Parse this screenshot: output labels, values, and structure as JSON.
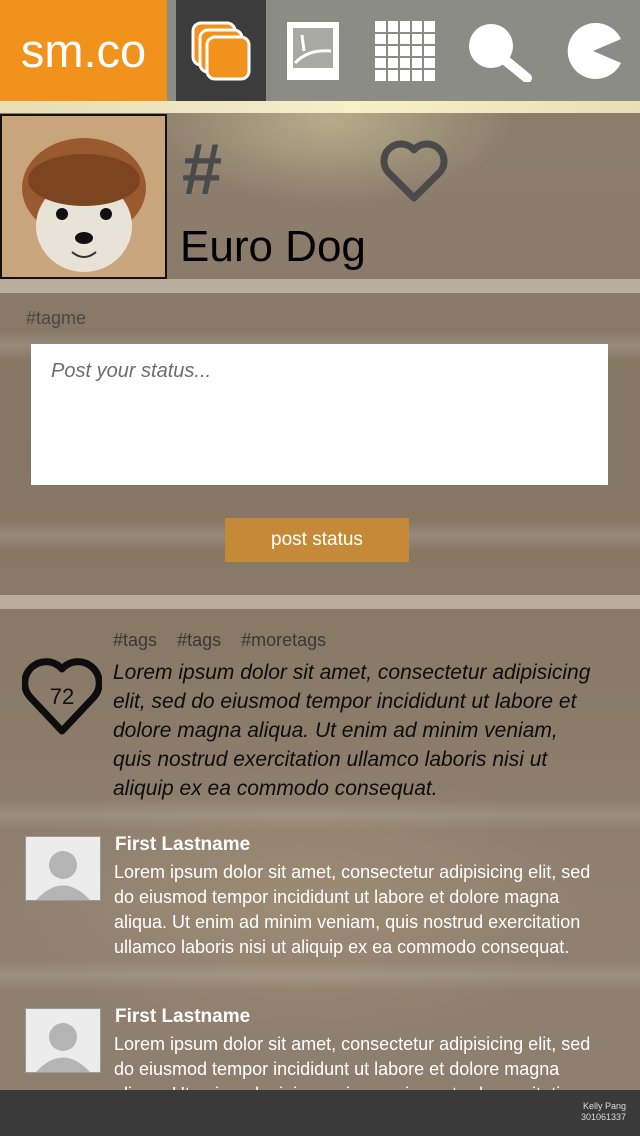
{
  "app": {
    "logo": "sm.co"
  },
  "nav": {
    "items": [
      {
        "name": "stack",
        "icon": "stack-icon",
        "active": true
      },
      {
        "name": "photos",
        "icon": "image-icon",
        "active": false
      },
      {
        "name": "calendar",
        "icon": "calendar-icon",
        "active": false
      },
      {
        "name": "search",
        "icon": "search-icon",
        "active": false
      },
      {
        "name": "chat",
        "icon": "pacman-icon",
        "active": false
      }
    ]
  },
  "profile": {
    "hash_symbol": "#",
    "name": "Euro Dog",
    "favorite_icon": "heart-outline-icon"
  },
  "composer": {
    "tag_hint": "#tagme",
    "placeholder": "Post your status...",
    "value": "",
    "post_label": "post status"
  },
  "feed": {
    "post": {
      "tags": [
        "#tags",
        "#tags",
        "#moretags"
      ],
      "likes": "72",
      "body": "Lorem ipsum dolor sit amet, consectetur adipisicing elit, sed do eiusmod tempor incididunt ut labore et dolore magna aliqua. Ut enim ad minim veniam, quis nostrud exercitation ullamco laboris nisi ut aliquip ex ea commodo consequat."
    },
    "comments": [
      {
        "author": "First Lastname",
        "text": "Lorem ipsum dolor sit amet, consectetur adipisicing elit, sed do eiusmod tempor incididunt ut labore et dolore magna aliqua. Ut enim ad minim veniam, quis nostrud exercitation ullamco laboris nisi ut aliquip ex ea commodo consequat."
      },
      {
        "author": "First Lastname",
        "text": "Lorem ipsum dolor sit amet, consectetur adipisicing elit, sed do eiusmod tempor incididunt ut labore et dolore magna aliqua. Ut enim ad minim veniam, quis nostrud exercitation ullamco laboris nisi ut aliquip ex ea commodo consequat."
      }
    ]
  },
  "footer": {
    "author": "Kelly Pang",
    "id": "301061337"
  },
  "colors": {
    "brand": "#f0921b",
    "button": "#c58a38",
    "nav_active": "#3d3d3d",
    "footer": "#3a3a3a"
  }
}
